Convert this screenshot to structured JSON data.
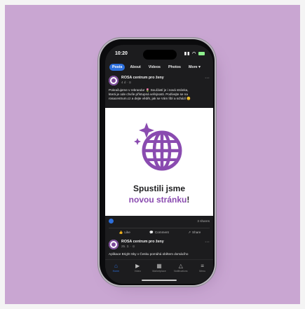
{
  "status_bar": {
    "time": "10:20"
  },
  "tabs": [
    {
      "label": "Posts",
      "active": true
    },
    {
      "label": "About"
    },
    {
      "label": "Videos"
    },
    {
      "label": "Photos"
    },
    {
      "label": "More ▾"
    }
  ],
  "post": {
    "author": "ROSA centrum pro ženy",
    "meta": "4 d · ⊙",
    "text_line1": "Pokračujeme v rebrandu! 🌷 Součástí je i nová stránka,",
    "text_line2": "která je ode chvíle přístupná veřejnosti. Podívejte se na",
    "text_line3": "rosacentrum.cz a dejte vědět, jak se Vám líbí a schází 😊",
    "image_line1": "Spustili jsme",
    "image_line2": "novou stránku",
    "image_bang": "!",
    "shares": "3 shares",
    "actions": [
      "Like",
      "Comment",
      "Share"
    ]
  },
  "post2": {
    "author": "ROSA centrum pro ženy",
    "meta": "25. 3. · ⊙",
    "text": "Aplikace Bright Sky v Česku pomáhá obětem domácího"
  },
  "navbar": [
    "Home",
    "Video",
    "Marketplace",
    "Notifications",
    "Menu"
  ],
  "colors": {
    "accent": "#2d6fdb",
    "brand_purple": "#8a4bb0",
    "backdrop": "#c9a6d2"
  }
}
